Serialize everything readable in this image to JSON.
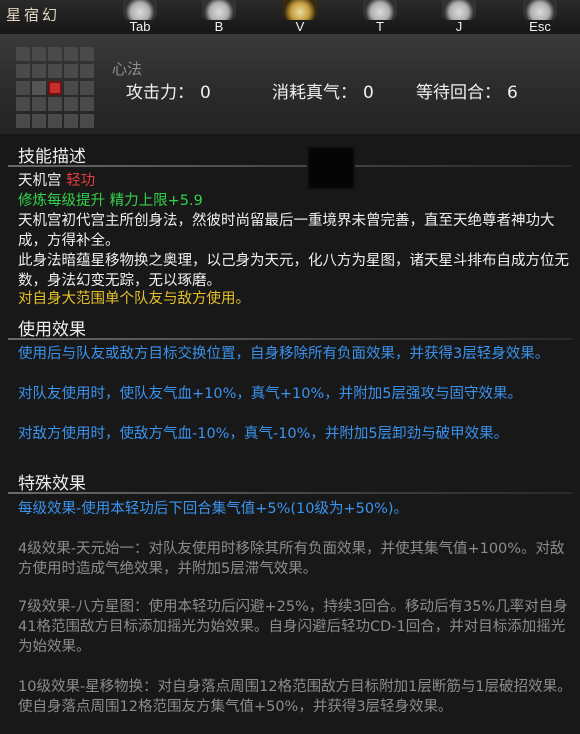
{
  "window": {
    "title": "星宿幻"
  },
  "hotkeys": [
    {
      "key": "Tab",
      "icon": "tab-ink-icon"
    },
    {
      "key": "B",
      "icon": "backpack-ink-icon"
    },
    {
      "key": "V",
      "icon": "skill-scroll-icon"
    },
    {
      "key": "T",
      "icon": "team-ink-icon"
    },
    {
      "key": "J",
      "icon": "journal-ink-icon"
    },
    {
      "key": "Esc",
      "icon": "menu-ink-icon"
    }
  ],
  "header": {
    "style_label": "心法",
    "stats": [
      {
        "label": "攻击力：",
        "value": "0"
      },
      {
        "label": "消耗真气：",
        "value": "0"
      },
      {
        "label": "等待回合：",
        "value": "6"
      }
    ],
    "range_grid": {
      "rows": 5,
      "cols": 5,
      "active_cells": [
        [
          2,
          1
        ],
        [
          2,
          2
        ]
      ]
    }
  },
  "skill_desc": {
    "title": "技能描述",
    "school": "天机宫",
    "type": "轻功",
    "upgrade": "修炼每级提升 精力上限+5.9",
    "lore": "天机宫初代宫主所创身法，然彼时尚留最后一重境界未曾完善，直至天绝尊者神功大成，方得补全。\n此身法暗蕴星移物换之奥理，以己身为天元，化八方为星图，诸天星斗排布自成方位无数，身法幻变无踪，无以琢磨。",
    "target": "对自身大范围单个队友与敌方使用。"
  },
  "use_effect": {
    "title": "使用效果",
    "lines": [
      "使用后与队友或敌方目标交换位置，自身移除所有负面效果，并获得3层轻身效果。",
      "对队友使用时，使队友气血+10%，真气+10%，并附加5层强攻与固守效果。",
      "对敌方使用时，使敌方气血-10%，真气-10%，并附加5层卸劲与破甲效果。"
    ]
  },
  "special_effect": {
    "title": "特殊效果",
    "per_level": "每级效果-使用本轻功后下回合集气值+5%(10级为+50%)。",
    "tiers": [
      "4级效果-天元始一：对队友使用时移除其所有负面效果，并使其集气值+100%。对敌方使用时造成气绝效果，并附加5层滞气效果。",
      "7级效果-八方星图：使用本轻功后闪避+25%，持续3回合。移动后有35%几率对自身41格范围敌方目标添加摇光为始效果。自身闪避后轻功CD-1回合，并对目标添加摇光为始效果。",
      "10级效果-星移物换：对自身落点周围12格范围敌方目标附加1层断筋与1层破招效果。使自身落点周围12格范围友方集气值+50%，并获得3层轻身效果。"
    ]
  },
  "colors": {
    "school": "#efefef",
    "type": "#e43b3b",
    "upgrade": "#33d24a",
    "target": "#e6c02a",
    "effect": "#3a93ee",
    "locked": "#8c8c8c"
  }
}
